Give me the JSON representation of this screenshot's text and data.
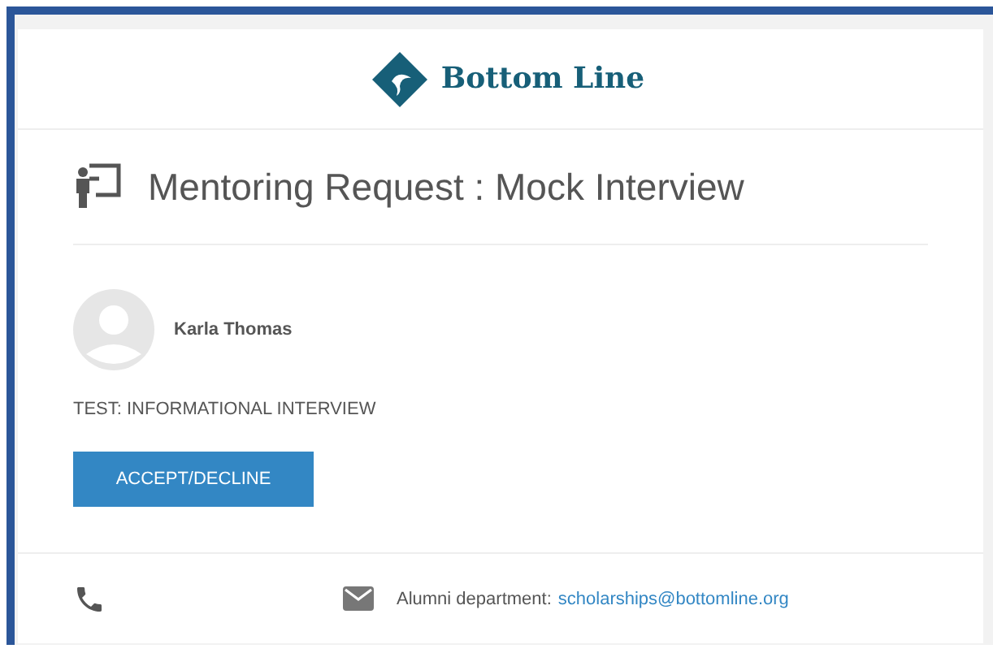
{
  "logo": {
    "text": "Bottom Line"
  },
  "title": "Mentoring Request : Mock Interview",
  "mentor": {
    "name": "Karla Thomas"
  },
  "request_note": "TEST: INFORMATIONAL INTERVIEW",
  "button": "ACCEPT/DECLINE",
  "footer": {
    "contact_label": "Alumni department:",
    "email": "scholarships@bottomline.org"
  }
}
